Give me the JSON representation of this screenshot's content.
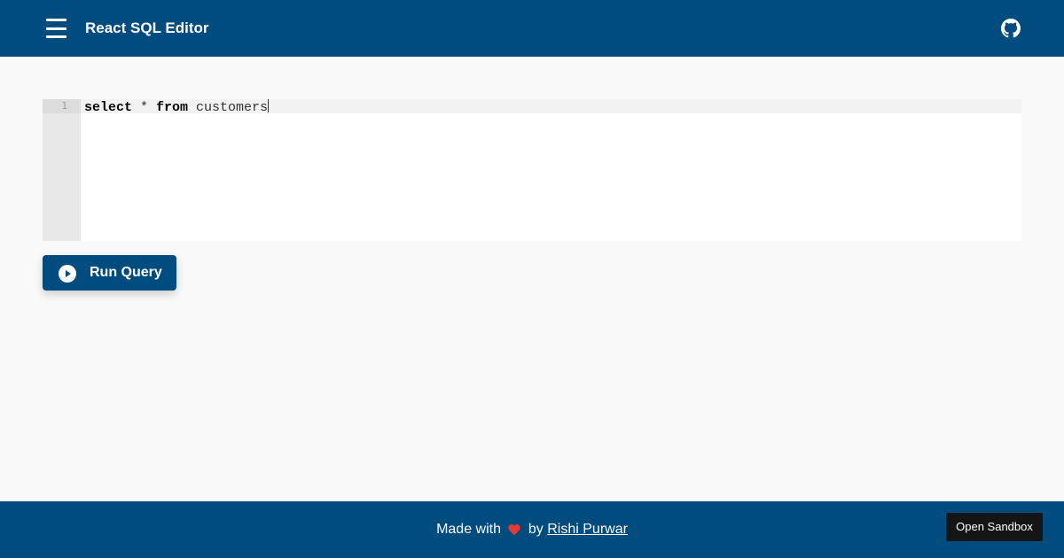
{
  "header": {
    "title": "React SQL Editor",
    "menu_icon": "hamburger-menu-icon",
    "github_icon": "github-icon"
  },
  "editor": {
    "line_numbers": [
      "1"
    ],
    "query": {
      "keyword_select": "select",
      "star": " * ",
      "keyword_from": "from",
      "table": " customers"
    }
  },
  "run_button": {
    "label": "Run Query",
    "icon": "play-circle-icon"
  },
  "footer": {
    "made_with": "Made with",
    "by": "by",
    "author": "Rishi Purwar",
    "heart_icon": "heart-icon",
    "sandbox_label": "Open Sandbox"
  },
  "colors": {
    "primary": "#014c7e",
    "background": "#f9f9f9",
    "heart": "#e53935",
    "sandbox_bg": "#151515"
  }
}
